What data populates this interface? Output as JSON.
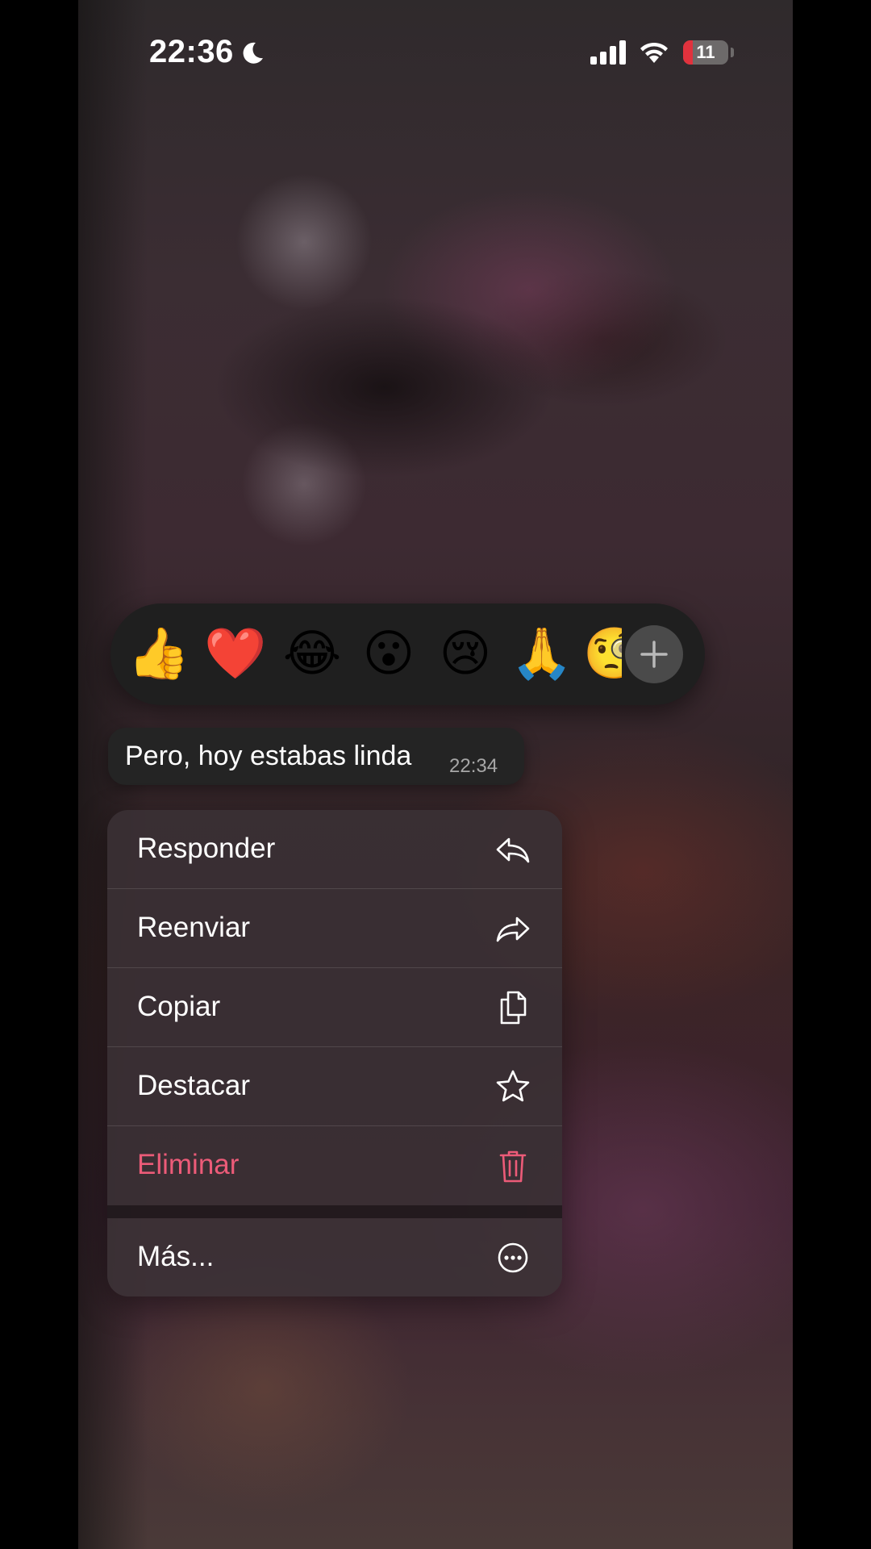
{
  "status_bar": {
    "time": "22:36",
    "focus_icon": "moon-icon",
    "signal_icon": "cellular-signal-icon",
    "wifi_icon": "wifi-icon",
    "battery_level": "11",
    "battery_fraction": 0.11,
    "battery_color": "#e1323d"
  },
  "reactions": {
    "emojis": [
      {
        "name": "thumbs-up-emoji",
        "glyph": "👍"
      },
      {
        "name": "red-heart-emoji",
        "glyph": "❤️"
      },
      {
        "name": "tears-of-joy-emoji",
        "glyph": "😂"
      },
      {
        "name": "surprised-emoji",
        "glyph": "😮"
      },
      {
        "name": "crying-emoji",
        "glyph": "😢"
      },
      {
        "name": "folded-hands-emoji",
        "glyph": "🙏"
      },
      {
        "name": "face-with-monocle-emoji",
        "glyph": "🧐"
      }
    ],
    "more_icon": "plus-icon"
  },
  "message": {
    "text": "Pero, hoy estabas linda",
    "time": "22:34"
  },
  "menu": {
    "items": [
      {
        "label": "Responder",
        "icon": "reply-icon"
      },
      {
        "label": "Reenviar",
        "icon": "forward-icon"
      },
      {
        "label": "Copiar",
        "icon": "copy-icon"
      },
      {
        "label": "Destacar",
        "icon": "star-icon"
      },
      {
        "label": "Eliminar",
        "icon": "trash-icon",
        "color": "#ec5b78"
      }
    ],
    "more": {
      "label": "Más...",
      "icon": "more-ellipsis-icon"
    }
  }
}
